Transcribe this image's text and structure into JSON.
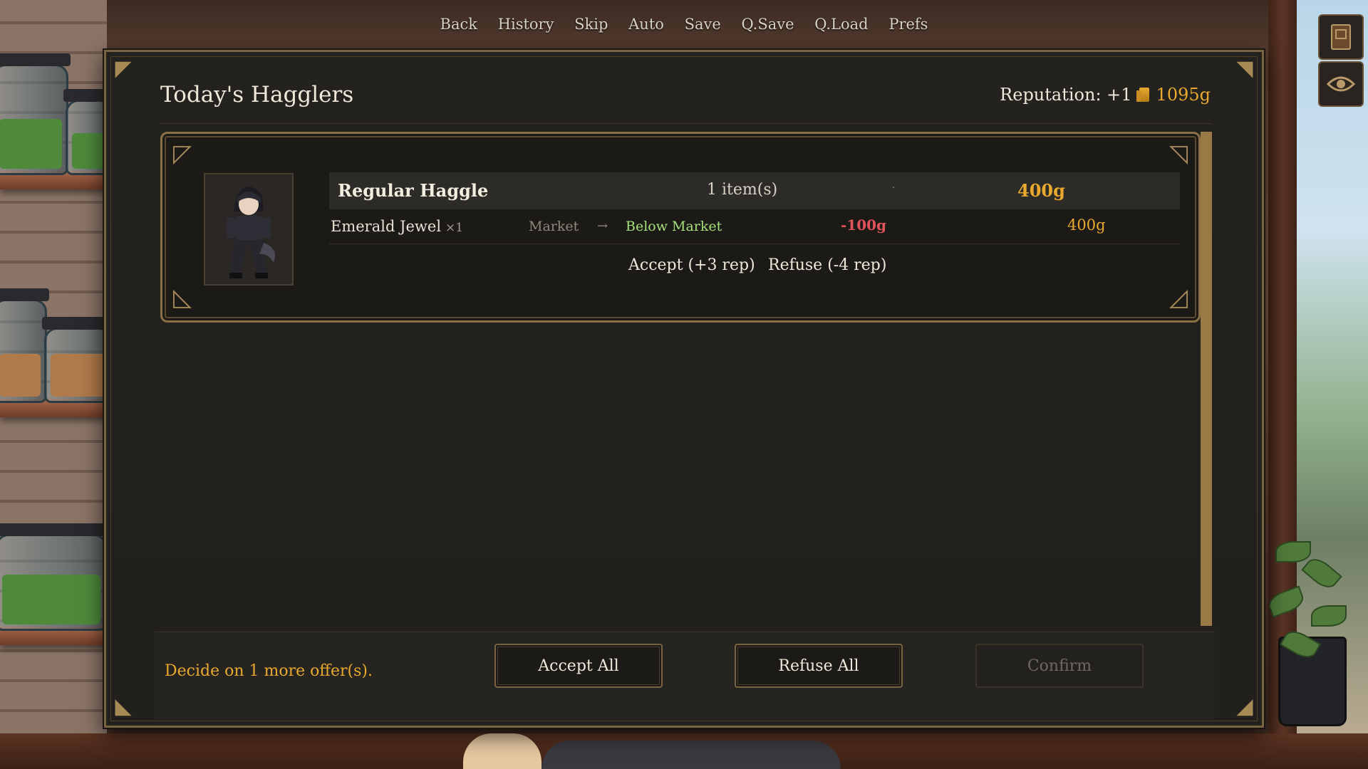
{
  "quick_menu": {
    "items": [
      "Back",
      "History",
      "Skip",
      "Auto",
      "Save",
      "Q.Save",
      "Q.Load",
      "Prefs"
    ]
  },
  "side_buttons": {
    "journal_icon": "book-icon",
    "view_icon": "eye-icon"
  },
  "panel": {
    "title": "Today's Hagglers",
    "reputation_label": "Reputation: +1",
    "gold": "1095g"
  },
  "offers": [
    {
      "type": "Regular Haggle",
      "item_count": "1 item(s)",
      "separator": "·",
      "total": "400g",
      "items": [
        {
          "name": "Emerald Jewel",
          "qty": "×1",
          "market_label": "Market",
          "arrow": "→",
          "status": "Below Market",
          "diff": "-100g",
          "price": "400g"
        }
      ],
      "accept_label": "Accept (+3 rep)",
      "refuse_label": "Refuse (-4 rep)"
    }
  ],
  "footer": {
    "message": "Decide on 1 more offer(s).",
    "accept_all": "Accept All",
    "refuse_all": "Refuse All",
    "confirm": "Confirm"
  },
  "colors": {
    "gold": "#e9a92e",
    "below_market": "#a6e07a",
    "negative": "#e0535a",
    "frame": "#7a6440"
  }
}
